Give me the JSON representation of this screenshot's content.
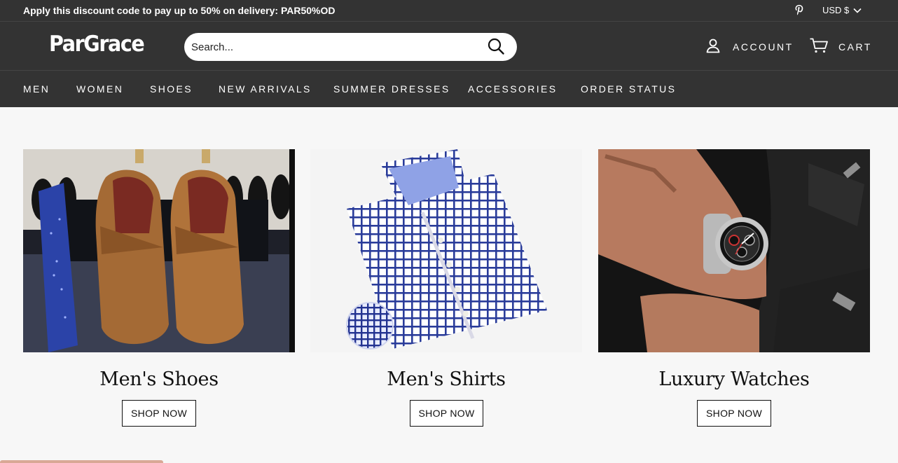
{
  "announcement": {
    "text": "Apply this discount code to pay up to 50% on delivery: PAR50%OD"
  },
  "currency": {
    "label": "USD $",
    "icon": "chevron-down-icon"
  },
  "header": {
    "logo": "ParGrace",
    "search_placeholder": "Search...",
    "account_label": "ACCOUNT",
    "cart_label": "CART"
  },
  "nav": {
    "items": [
      {
        "label": "MEN"
      },
      {
        "label": "WOMEN"
      },
      {
        "label": "SHOES"
      },
      {
        "label": "NEW ARRIVALS"
      },
      {
        "label": "SUMMER DRESSES"
      },
      {
        "label": "ACCESSORIES"
      },
      {
        "label": "ORDER STATUS"
      }
    ]
  },
  "collections": [
    {
      "title": "Men's Shoes",
      "button": "SHOP NOW"
    },
    {
      "title": "Men's Shirts",
      "button": "SHOP NOW"
    },
    {
      "title": "Luxury Watches",
      "button": "SHOP NOW"
    }
  ],
  "colors": {
    "header_bg": "#333333",
    "page_bg": "#f7f7f7",
    "text_light": "#ffffff"
  }
}
